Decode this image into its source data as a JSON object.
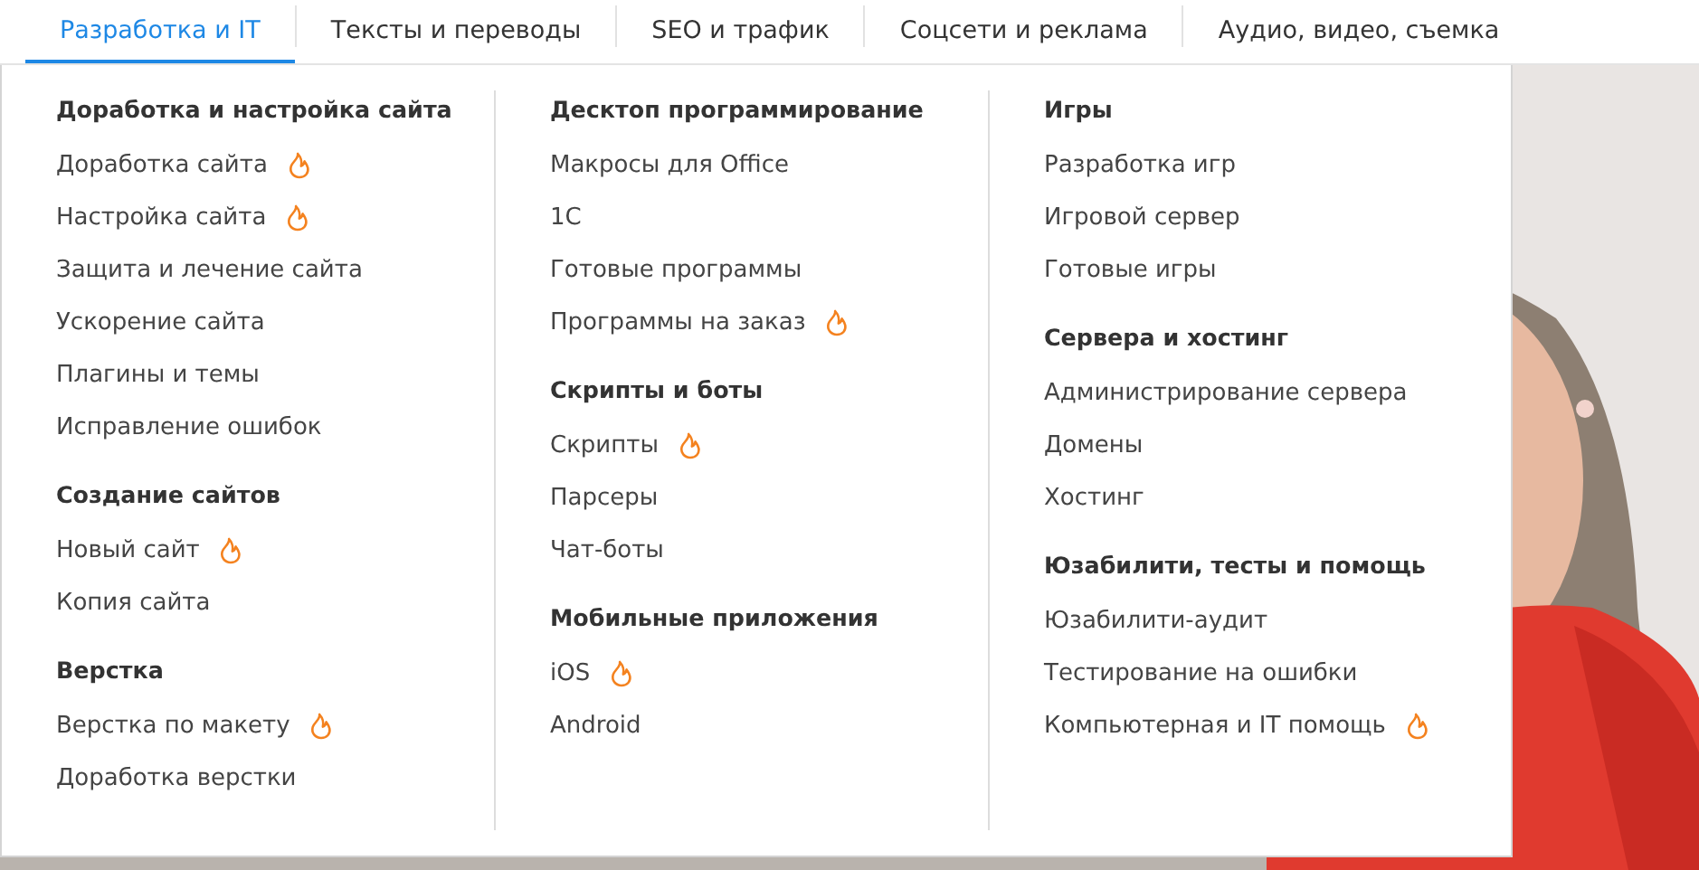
{
  "tabs": [
    {
      "label": "Разработка и IT",
      "selected": true
    },
    {
      "label": "Тексты и переводы",
      "selected": false
    },
    {
      "label": "SEO и трафик",
      "selected": false
    },
    {
      "label": "Соцсети и реклама",
      "selected": false
    },
    {
      "label": "Аудио, видео, съемка",
      "selected": false
    }
  ],
  "menu": {
    "columns": [
      {
        "groups": [
          {
            "title": "Доработка и настройка сайта",
            "items": [
              {
                "label": "Доработка сайта",
                "hot": true
              },
              {
                "label": "Настройка сайта",
                "hot": true
              },
              {
                "label": "Защита и лечение сайта",
                "hot": false
              },
              {
                "label": "Ускорение сайта",
                "hot": false
              },
              {
                "label": "Плагины и темы",
                "hot": false
              },
              {
                "label": "Исправление ошибок",
                "hot": false
              }
            ]
          },
          {
            "title": "Создание сайтов",
            "items": [
              {
                "label": "Новый сайт",
                "hot": true
              },
              {
                "label": "Копия сайта",
                "hot": false
              }
            ]
          },
          {
            "title": "Верстка",
            "items": [
              {
                "label": "Верстка по макету",
                "hot": true
              },
              {
                "label": "Доработка верстки",
                "hot": false
              }
            ]
          }
        ]
      },
      {
        "groups": [
          {
            "title": "Десктоп программирование",
            "items": [
              {
                "label": "Макросы для Office",
                "hot": false
              },
              {
                "label": "1С",
                "hot": false
              },
              {
                "label": "Готовые программы",
                "hot": false
              },
              {
                "label": "Программы на заказ",
                "hot": true
              }
            ]
          },
          {
            "title": "Скрипты и боты",
            "items": [
              {
                "label": "Скрипты",
                "hot": true
              },
              {
                "label": "Парсеры",
                "hot": false
              },
              {
                "label": "Чат-боты",
                "hot": false
              }
            ]
          },
          {
            "title": "Мобильные приложения",
            "items": [
              {
                "label": "iOS",
                "hot": true
              },
              {
                "label": "Android",
                "hot": false
              }
            ]
          }
        ]
      },
      {
        "groups": [
          {
            "title": "Игры",
            "items": [
              {
                "label": "Разработка игр",
                "hot": false
              },
              {
                "label": "Игровой сервер",
                "hot": false
              },
              {
                "label": "Готовые игры",
                "hot": false
              }
            ]
          },
          {
            "title": "Сервера и хостинг",
            "items": [
              {
                "label": "Администрирование сервера",
                "hot": false
              },
              {
                "label": "Домены",
                "hot": false
              },
              {
                "label": "Хостинг",
                "hot": false
              }
            ]
          },
          {
            "title": "Юзабилити, тесты и помощь",
            "items": [
              {
                "label": "Юзабилити-аудит",
                "hot": false
              },
              {
                "label": "Тестирование на ошибки",
                "hot": false
              },
              {
                "label": "Компьютерная и IT помощь",
                "hot": true
              }
            ]
          }
        ]
      }
    ]
  }
}
